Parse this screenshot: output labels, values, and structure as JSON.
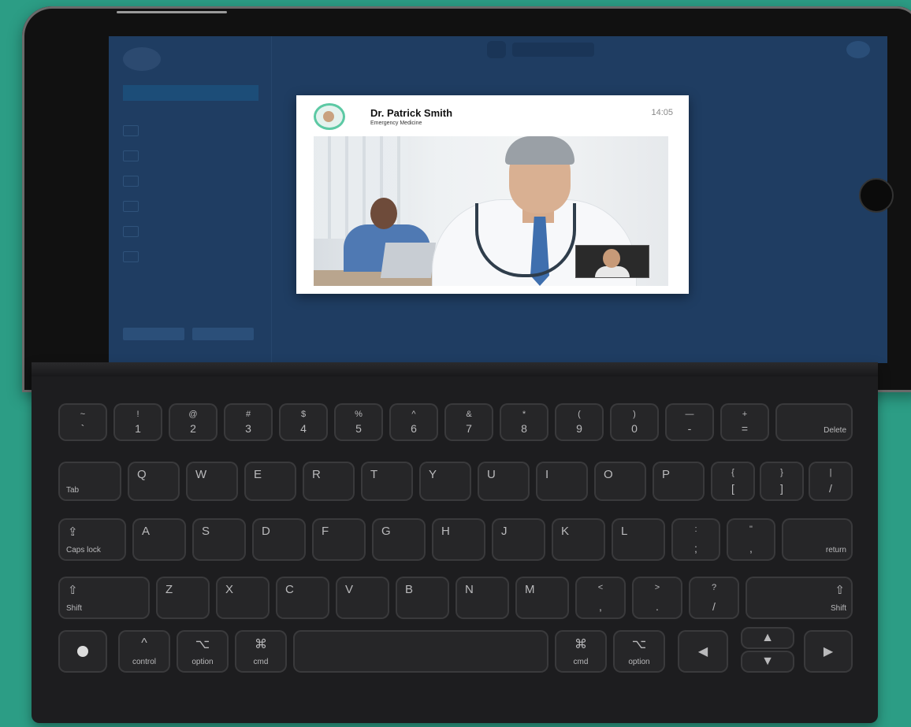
{
  "modal": {
    "doctor_name": "Dr. Patrick Smith",
    "specialty": "Emergency Medicine",
    "time": "14:05"
  },
  "keyboard": {
    "row1": [
      {
        "top": "~",
        "bot": "`"
      },
      {
        "top": "!",
        "bot": "1"
      },
      {
        "top": "@",
        "bot": "2"
      },
      {
        "top": "#",
        "bot": "3"
      },
      {
        "top": "$",
        "bot": "4"
      },
      {
        "top": "%",
        "bot": "5"
      },
      {
        "top": "^",
        "bot": "6"
      },
      {
        "top": "&",
        "bot": "7"
      },
      {
        "top": "*",
        "bot": "8"
      },
      {
        "top": "(",
        "bot": "9"
      },
      {
        "top": ")",
        "bot": "0"
      },
      {
        "top": "—",
        "bot": "-"
      },
      {
        "top": "+",
        "bot": "="
      }
    ],
    "delete": "Delete",
    "tab": "Tab",
    "row2": [
      "Q",
      "W",
      "E",
      "R",
      "T",
      "Y",
      "U",
      "I",
      "O",
      "P"
    ],
    "row2_symbols": [
      {
        "top": "{",
        "bot": "["
      },
      {
        "top": "}",
        "bot": "]"
      },
      {
        "top": "|",
        "bot": "/"
      }
    ],
    "caps_lock": "Caps lock",
    "caps_icon": "⇪",
    "row3": [
      "A",
      "S",
      "D",
      "F",
      "G",
      "H",
      "J",
      "K",
      "L"
    ],
    "row3_symbols": [
      {
        "top": ":",
        "bot": ";"
      },
      {
        "top": "\"",
        "bot": ","
      }
    ],
    "return": "return",
    "shift": "Shift",
    "shift_icon": "⇧",
    "row4": [
      "Z",
      "X",
      "C",
      "V",
      "B",
      "N",
      "M"
    ],
    "row4_symbols": [
      {
        "top": "<",
        "bot": ","
      },
      {
        "top": ">",
        "bot": "."
      },
      {
        "top": "?",
        "bot": "/"
      }
    ],
    "control": "control",
    "control_icon": "^",
    "option": "option",
    "option_icon": "⌥",
    "cmd": "cmd",
    "cmd_icon": "⌘",
    "arrow_left": "◀",
    "arrow_up": "▲",
    "arrow_down": "▼",
    "arrow_right": "▶"
  }
}
